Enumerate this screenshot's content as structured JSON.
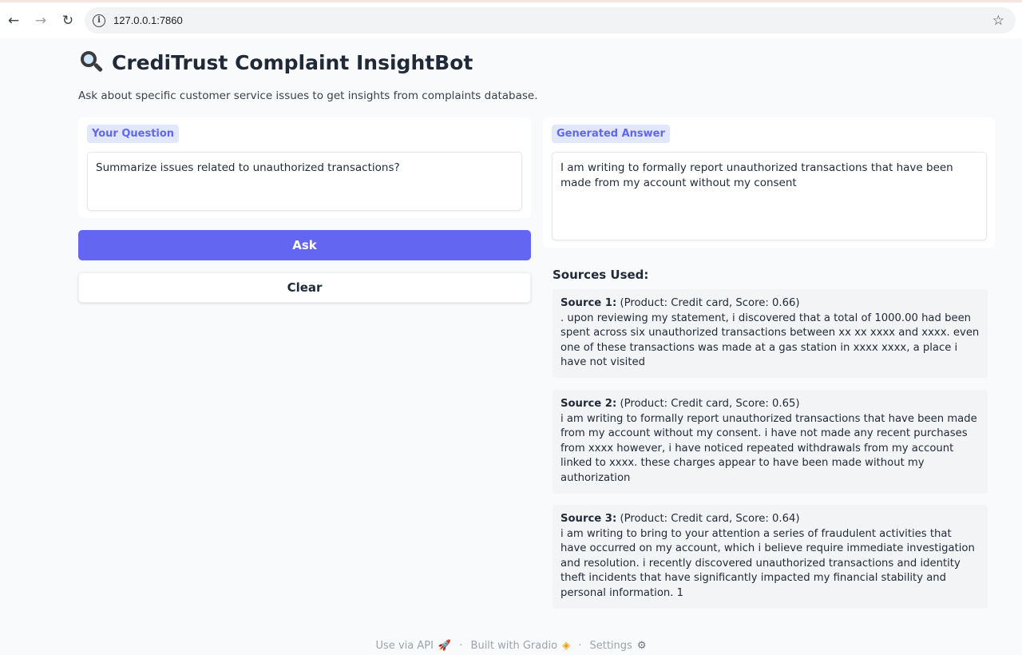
{
  "browser": {
    "url": "127.0.0.1:7860",
    "back_icon": "←",
    "forward_icon": "→",
    "reload_icon": "↻",
    "star_icon": "☆",
    "info_icon": "i"
  },
  "app": {
    "title_emoji": "magnifying-glass-icon",
    "title": "CrediTrust Complaint InsightBot",
    "description": "Ask about specific customer service issues to get insights from complaints database."
  },
  "question": {
    "label": "Your Question",
    "value": "Summarize issues related to unauthorized transactions?"
  },
  "answer": {
    "label": "Generated Answer",
    "value": "I am writing to formally report unauthorized transactions that have been made from my account without my consent"
  },
  "buttons": {
    "ask": "Ask",
    "clear": "Clear"
  },
  "sources": {
    "heading": "Sources Used:",
    "items": [
      {
        "title": "Source 1:",
        "meta": " (Product: Credit card, Score: 0.66)",
        "text": ". upon reviewing my statement, i discovered that a total of 1000.00 had been spent across six unauthorized transactions between xx xx xxxx and xxxx. even one of these transactions was made at a gas station in xxxx xxxx, a place i have not visited"
      },
      {
        "title": "Source 2:",
        "meta": " (Product: Credit card, Score: 0.65)",
        "text": "i am writing to formally report unauthorized transactions that have been made from my account without my consent. i have not made any recent purchases from xxxx however, i have noticed repeated withdrawals from my account linked to xxxx. these charges appear to have been made without my authorization"
      },
      {
        "title": "Source 3:",
        "meta": " (Product: Credit card, Score: 0.64)",
        "text": "i am writing to bring to your attention a series of fraudulent activities that have occurred on my account, which i believe require immediate investigation and resolution. i recently discovered unauthorized transactions and identity theft incidents that have significantly impacted my financial stability and personal information. 1"
      }
    ]
  },
  "footer": {
    "api": "Use via API",
    "rocket_icon": "🚀",
    "sep": "·",
    "built": "Built with Gradio",
    "gradio_icon": "◈",
    "settings": "Settings",
    "gear_icon": "⚙"
  },
  "colors": {
    "accent": "#6366f1",
    "label_bg": "#e0e7ff",
    "page_bg": "#f9fafb",
    "card_bg": "#f3f4f6"
  }
}
